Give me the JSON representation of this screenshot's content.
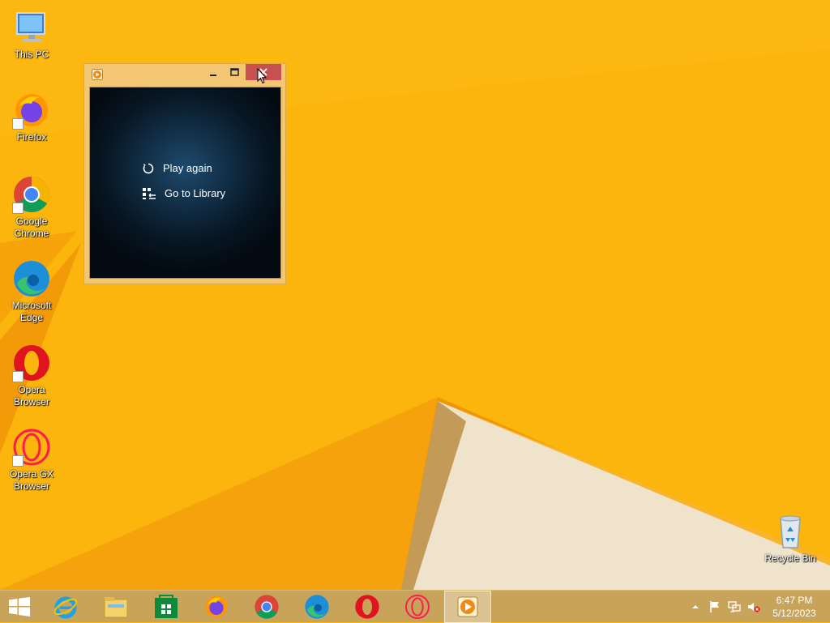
{
  "desktop": {
    "icons": [
      {
        "label": "This PC",
        "icon": "computer-icon"
      },
      {
        "label": "Firefox",
        "icon": "firefox-icon"
      },
      {
        "label": "Google Chrome",
        "icon": "chrome-icon"
      },
      {
        "label": "Microsoft Edge",
        "icon": "edge-icon"
      },
      {
        "label": "Opera Browser",
        "icon": "opera-icon"
      },
      {
        "label": "Opera GX Browser",
        "icon": "opera-gx-icon"
      }
    ],
    "recycle_bin": {
      "label": "Recycle Bin",
      "icon": "recycle-bin-icon"
    }
  },
  "player_window": {
    "app_icon": "windows-media-player-icon",
    "actions": [
      {
        "label": "Play again",
        "icon": "replay-icon"
      },
      {
        "label": "Go to Library",
        "icon": "library-icon"
      }
    ],
    "controls": [
      "minimize-icon",
      "maximize-icon",
      "close-icon"
    ]
  },
  "taskbar": {
    "start": "windows-logo-icon",
    "pinned": [
      "internet-explorer-icon",
      "file-explorer-icon",
      "store-icon",
      "firefox-icon",
      "chrome-icon",
      "edge-icon",
      "opera-icon",
      "opera-gx-icon",
      "windows-media-player-icon"
    ],
    "tray": [
      "show-hidden-icons-chevron",
      "action-center-flag-icon",
      "network-icon",
      "volume-muted-icon"
    ],
    "clock": {
      "time": "6:47 PM",
      "date": "5/12/2023"
    }
  },
  "colors": {
    "wallpaper": "#fbb50d",
    "taskbar": "#c8a45a",
    "close_button": "#c75050",
    "window_frame": "#f3c674"
  }
}
